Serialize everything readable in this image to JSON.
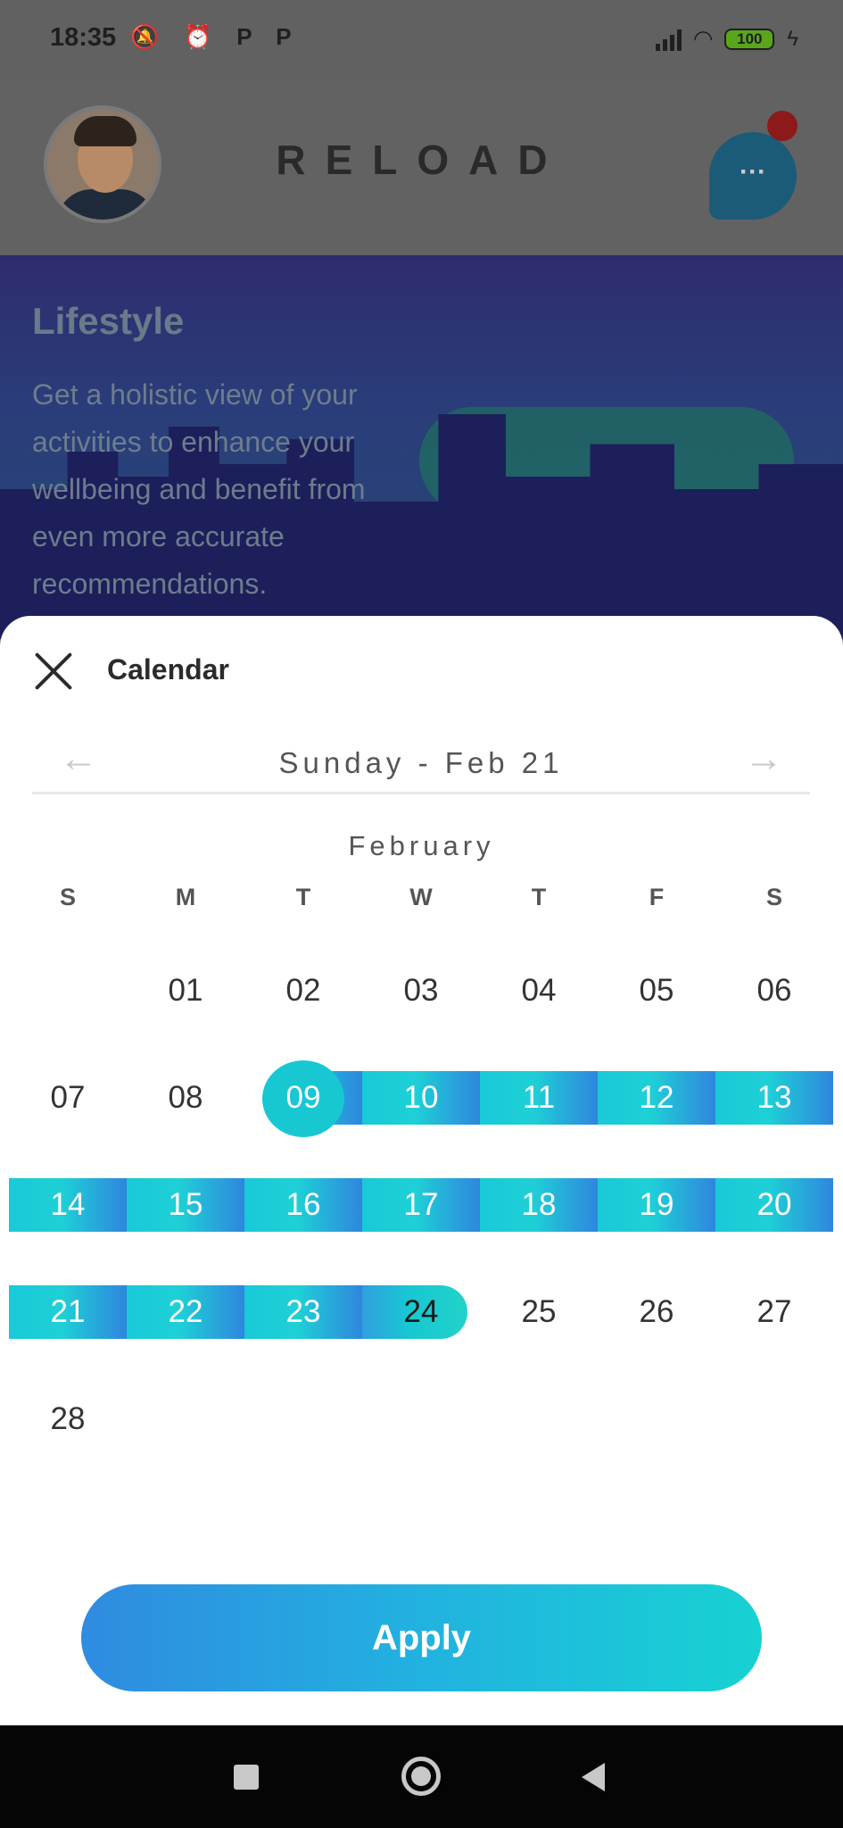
{
  "status_bar": {
    "time": "18:35",
    "left_icons": "🔕 ⏰ P P",
    "battery": "100"
  },
  "app_bar": {
    "logo": "RELOAD"
  },
  "hero": {
    "title": "Lifestyle",
    "text": "Get a holistic view of your activities to enhance your wellbeing and benefit from even more accurate recommendations."
  },
  "calendar": {
    "title": "Calendar",
    "prev_arrow": "←",
    "next_arrow": "→",
    "selected_label": "Sunday - Feb 21",
    "month": "February",
    "weekdays": [
      "S",
      "M",
      "T",
      "W",
      "T",
      "F",
      "S"
    ],
    "weeks": [
      [
        "",
        "01",
        "02",
        "03",
        "04",
        "05",
        "06"
      ],
      [
        "07",
        "08",
        "09",
        "10",
        "11",
        "12",
        "13"
      ],
      [
        "14",
        "15",
        "16",
        "17",
        "18",
        "19",
        "20"
      ],
      [
        "21",
        "22",
        "23",
        "24",
        "25",
        "26",
        "27"
      ],
      [
        "28",
        "",
        "",
        "",
        "",
        "",
        ""
      ]
    ],
    "range_start": "09",
    "range_end": "24",
    "apply_label": "Apply"
  },
  "colors": {
    "accent_teal": "#17c8d2",
    "accent_blue": "#2f86de"
  }
}
